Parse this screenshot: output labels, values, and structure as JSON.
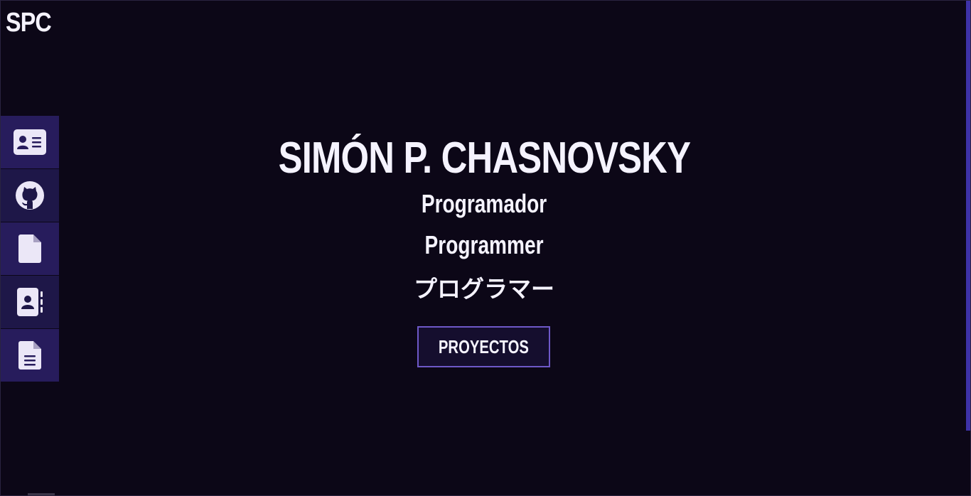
{
  "brand": {
    "logo_text": "SPC"
  },
  "sidebar": {
    "items": [
      {
        "icon": "id-card-icon",
        "name": "sidebar-item-about"
      },
      {
        "icon": "github-icon",
        "name": "sidebar-item-github"
      },
      {
        "icon": "file-icon",
        "name": "sidebar-item-document"
      },
      {
        "icon": "contact-book-icon",
        "name": "sidebar-item-contact"
      },
      {
        "icon": "file-text-icon",
        "name": "sidebar-item-resume"
      }
    ]
  },
  "hero": {
    "name": "SIMÓN P. CHASNOVSKY",
    "roles": [
      "Programador",
      "Programmer",
      "プログラマー"
    ],
    "cta_label": "PROYECTOS"
  },
  "colors": {
    "background": "#0c0717",
    "sidebar": "#271c5c",
    "accent_border": "#6e58c8",
    "scrollbar": "#3e32a8",
    "text": "#f5f3ff"
  }
}
